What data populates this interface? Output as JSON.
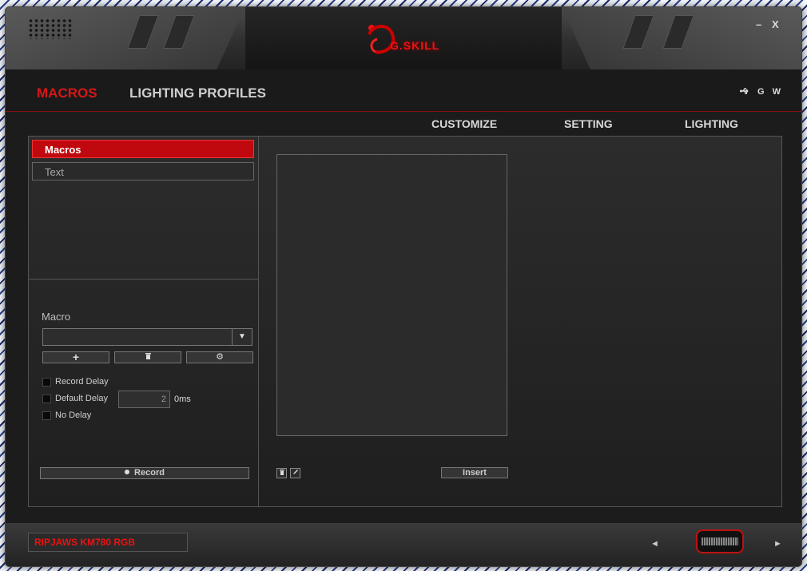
{
  "window": {
    "brand": "G.SKILL",
    "minimize_label": "–",
    "close_label": "X"
  },
  "nav": {
    "tabs": [
      {
        "label": "MACROS",
        "active": true
      },
      {
        "label": "LIGHTING PROFILES",
        "active": false
      }
    ],
    "header_icons": {
      "usb": "usb-icon",
      "g_label": "G",
      "w_label": "W"
    }
  },
  "subnav": {
    "items": [
      {
        "label": "CUSTOMIZE"
      },
      {
        "label": "SETTING"
      },
      {
        "label": "LIGHTING"
      }
    ]
  },
  "macro_list": {
    "items": [
      {
        "label": "Macros",
        "selected": true
      },
      {
        "label": "Text",
        "selected": false
      }
    ]
  },
  "macro_panel": {
    "label": "Macro",
    "dropdown_value": "",
    "add_icon": "plus-icon",
    "delete_icon": "trash-icon",
    "settings_icon": "gear-icon",
    "record_delay_label": "Record Delay",
    "default_delay_label": "Default Delay",
    "default_delay_value": "2",
    "delay_unit": "0ms",
    "no_delay_label": "No Delay",
    "record_label": "Record"
  },
  "editor": {
    "insert_label": "Insert",
    "delete_icon": "trash-icon",
    "edit_icon": "pencil-icon"
  },
  "footer": {
    "device_name": "RIPJAWS KM780 RGB",
    "prev_icon": "triangle-left-icon",
    "next_icon": "triangle-right-icon"
  },
  "colors": {
    "accent": "#d41818",
    "selected_bg": "#c0090e",
    "panel_bg": "#2c2c2c"
  }
}
